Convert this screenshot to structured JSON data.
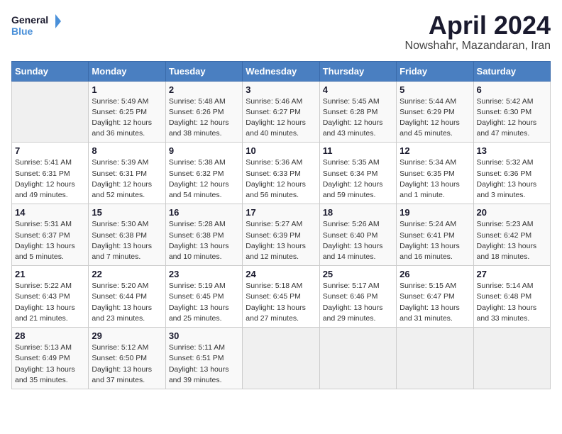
{
  "header": {
    "logo_line1": "General",
    "logo_line2": "Blue",
    "month": "April 2024",
    "location": "Nowshahr, Mazandaran, Iran"
  },
  "weekdays": [
    "Sunday",
    "Monday",
    "Tuesday",
    "Wednesday",
    "Thursday",
    "Friday",
    "Saturday"
  ],
  "weeks": [
    [
      {
        "day": "",
        "info": ""
      },
      {
        "day": "1",
        "info": "Sunrise: 5:49 AM\nSunset: 6:25 PM\nDaylight: 12 hours\nand 36 minutes."
      },
      {
        "day": "2",
        "info": "Sunrise: 5:48 AM\nSunset: 6:26 PM\nDaylight: 12 hours\nand 38 minutes."
      },
      {
        "day": "3",
        "info": "Sunrise: 5:46 AM\nSunset: 6:27 PM\nDaylight: 12 hours\nand 40 minutes."
      },
      {
        "day": "4",
        "info": "Sunrise: 5:45 AM\nSunset: 6:28 PM\nDaylight: 12 hours\nand 43 minutes."
      },
      {
        "day": "5",
        "info": "Sunrise: 5:44 AM\nSunset: 6:29 PM\nDaylight: 12 hours\nand 45 minutes."
      },
      {
        "day": "6",
        "info": "Sunrise: 5:42 AM\nSunset: 6:30 PM\nDaylight: 12 hours\nand 47 minutes."
      }
    ],
    [
      {
        "day": "7",
        "info": "Sunrise: 5:41 AM\nSunset: 6:31 PM\nDaylight: 12 hours\nand 49 minutes."
      },
      {
        "day": "8",
        "info": "Sunrise: 5:39 AM\nSunset: 6:31 PM\nDaylight: 12 hours\nand 52 minutes."
      },
      {
        "day": "9",
        "info": "Sunrise: 5:38 AM\nSunset: 6:32 PM\nDaylight: 12 hours\nand 54 minutes."
      },
      {
        "day": "10",
        "info": "Sunrise: 5:36 AM\nSunset: 6:33 PM\nDaylight: 12 hours\nand 56 minutes."
      },
      {
        "day": "11",
        "info": "Sunrise: 5:35 AM\nSunset: 6:34 PM\nDaylight: 12 hours\nand 59 minutes."
      },
      {
        "day": "12",
        "info": "Sunrise: 5:34 AM\nSunset: 6:35 PM\nDaylight: 13 hours\nand 1 minute."
      },
      {
        "day": "13",
        "info": "Sunrise: 5:32 AM\nSunset: 6:36 PM\nDaylight: 13 hours\nand 3 minutes."
      }
    ],
    [
      {
        "day": "14",
        "info": "Sunrise: 5:31 AM\nSunset: 6:37 PM\nDaylight: 13 hours\nand 5 minutes."
      },
      {
        "day": "15",
        "info": "Sunrise: 5:30 AM\nSunset: 6:38 PM\nDaylight: 13 hours\nand 7 minutes."
      },
      {
        "day": "16",
        "info": "Sunrise: 5:28 AM\nSunset: 6:38 PM\nDaylight: 13 hours\nand 10 minutes."
      },
      {
        "day": "17",
        "info": "Sunrise: 5:27 AM\nSunset: 6:39 PM\nDaylight: 13 hours\nand 12 minutes."
      },
      {
        "day": "18",
        "info": "Sunrise: 5:26 AM\nSunset: 6:40 PM\nDaylight: 13 hours\nand 14 minutes."
      },
      {
        "day": "19",
        "info": "Sunrise: 5:24 AM\nSunset: 6:41 PM\nDaylight: 13 hours\nand 16 minutes."
      },
      {
        "day": "20",
        "info": "Sunrise: 5:23 AM\nSunset: 6:42 PM\nDaylight: 13 hours\nand 18 minutes."
      }
    ],
    [
      {
        "day": "21",
        "info": "Sunrise: 5:22 AM\nSunset: 6:43 PM\nDaylight: 13 hours\nand 21 minutes."
      },
      {
        "day": "22",
        "info": "Sunrise: 5:20 AM\nSunset: 6:44 PM\nDaylight: 13 hours\nand 23 minutes."
      },
      {
        "day": "23",
        "info": "Sunrise: 5:19 AM\nSunset: 6:45 PM\nDaylight: 13 hours\nand 25 minutes."
      },
      {
        "day": "24",
        "info": "Sunrise: 5:18 AM\nSunset: 6:45 PM\nDaylight: 13 hours\nand 27 minutes."
      },
      {
        "day": "25",
        "info": "Sunrise: 5:17 AM\nSunset: 6:46 PM\nDaylight: 13 hours\nand 29 minutes."
      },
      {
        "day": "26",
        "info": "Sunrise: 5:15 AM\nSunset: 6:47 PM\nDaylight: 13 hours\nand 31 minutes."
      },
      {
        "day": "27",
        "info": "Sunrise: 5:14 AM\nSunset: 6:48 PM\nDaylight: 13 hours\nand 33 minutes."
      }
    ],
    [
      {
        "day": "28",
        "info": "Sunrise: 5:13 AM\nSunset: 6:49 PM\nDaylight: 13 hours\nand 35 minutes."
      },
      {
        "day": "29",
        "info": "Sunrise: 5:12 AM\nSunset: 6:50 PM\nDaylight: 13 hours\nand 37 minutes."
      },
      {
        "day": "30",
        "info": "Sunrise: 5:11 AM\nSunset: 6:51 PM\nDaylight: 13 hours\nand 39 minutes."
      },
      {
        "day": "",
        "info": ""
      },
      {
        "day": "",
        "info": ""
      },
      {
        "day": "",
        "info": ""
      },
      {
        "day": "",
        "info": ""
      }
    ]
  ]
}
